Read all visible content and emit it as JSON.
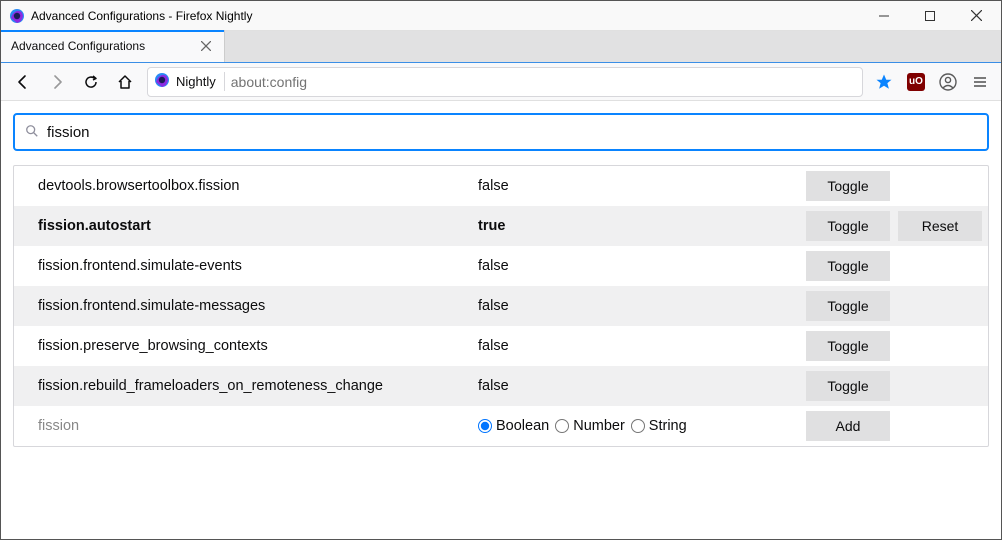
{
  "window": {
    "title": "Advanced Configurations - Firefox Nightly"
  },
  "tab": {
    "label": "Advanced Configurations"
  },
  "nav": {
    "identity_label": "Nightly",
    "url": "about:config"
  },
  "search": {
    "value": "fission"
  },
  "buttons": {
    "toggle": "Toggle",
    "reset": "Reset",
    "add": "Add"
  },
  "prefs": [
    {
      "name": "devtools.browsertoolbox.fission",
      "value": "false",
      "modified": false,
      "hasReset": false
    },
    {
      "name": "fission.autostart",
      "value": "true",
      "modified": true,
      "hasReset": true
    },
    {
      "name": "fission.frontend.simulate-events",
      "value": "false",
      "modified": false,
      "hasReset": false
    },
    {
      "name": "fission.frontend.simulate-messages",
      "value": "false",
      "modified": false,
      "hasReset": false
    },
    {
      "name": "fission.preserve_browsing_contexts",
      "value": "false",
      "modified": false,
      "hasReset": false
    },
    {
      "name": "fission.rebuild_frameloaders_on_remoteness_change",
      "value": "false",
      "modified": false,
      "hasReset": false
    }
  ],
  "new_pref": {
    "name": "fission",
    "types": [
      "Boolean",
      "Number",
      "String"
    ],
    "selected": "Boolean"
  }
}
